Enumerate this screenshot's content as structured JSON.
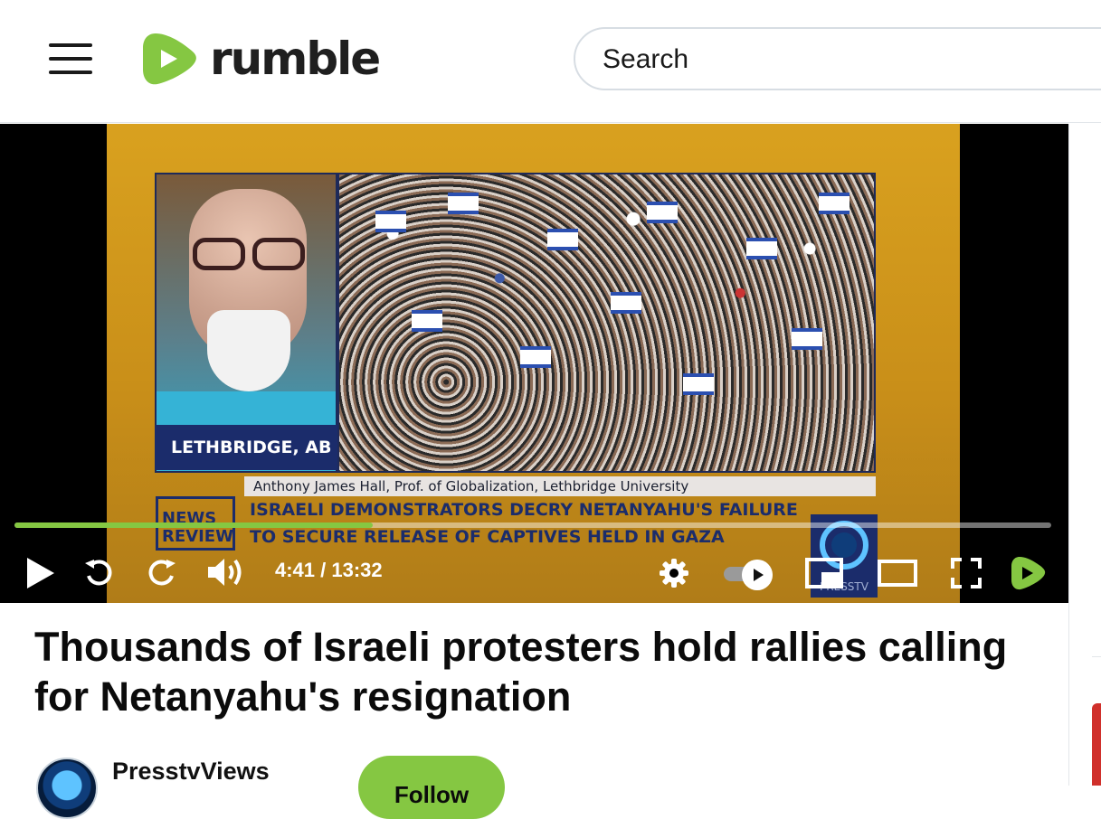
{
  "header": {
    "brand_name": "rumble",
    "search_placeholder": "Search"
  },
  "player": {
    "guest_location": "LETHBRIDGE, AB",
    "guest_caption": "Anthony James Hall, Prof. of Globalization, Lethbridge University",
    "news_badge": "NEWS REVIEW",
    "headline_line1": "ISRAELI DEMONSTRATORS DECRY NETANYAHU'S FAILURE",
    "headline_line2": "TO SECURE RELEASE OF CAPTIVES HELD IN GAZA",
    "channel_logo_text": "PRESSTV",
    "time_display": "4:41 / 13:32",
    "progress_fraction": 0.3459,
    "autoplay_on": true,
    "accent_color": "#85c742"
  },
  "video": {
    "title": "Thousands of Israeli protesters hold rallies calling for Netanyahu's resignation"
  },
  "channel": {
    "name": "PresstvViews",
    "follow_label": "Follow"
  },
  "icons": [
    "menu-icon",
    "rumble-logo-icon",
    "play-icon",
    "rewind-icon",
    "forward-icon",
    "volume-icon",
    "settings-icon",
    "autoplay-toggle",
    "miniplayer-icon",
    "theater-icon",
    "fullscreen-icon",
    "rumble-brand-icon"
  ]
}
